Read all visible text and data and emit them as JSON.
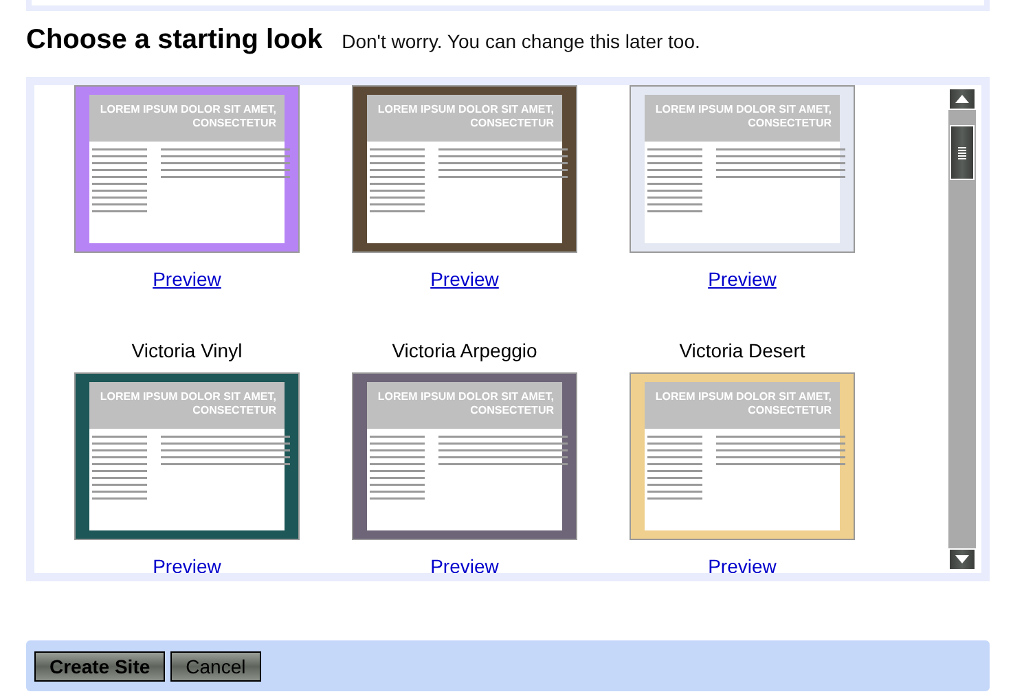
{
  "heading": {
    "title": "Choose a starting look",
    "subtitle": "Don't worry. You can change this later too."
  },
  "rows": [
    {
      "themes": [
        {
          "color": "#b784f5",
          "headline": "LOREM IPSUM DOLOR SIT AMET, CONSECTETUR",
          "link": "Preview"
        },
        {
          "color": "#5c4a36",
          "headline": "LOREM IPSUM DOLOR SIT AMET, CONSECTETUR",
          "link": "Preview"
        },
        {
          "color": "#e4e8f2",
          "headline": "LOREM IPSUM DOLOR SIT AMET, CONSECTETUR",
          "link": "Preview"
        }
      ]
    },
    {
      "themes": [
        {
          "name": "Victoria Vinyl",
          "color": "#1d5757",
          "headline": "LOREM IPSUM DOLOR SIT AMET, CONSECTETUR",
          "link": "Preview"
        },
        {
          "name": "Victoria Arpeggio",
          "color": "#6e6578",
          "headline": "LOREM IPSUM DOLOR SIT AMET, CONSECTETUR",
          "link": "Preview"
        },
        {
          "name": "Victoria Desert",
          "color": "#efd08e",
          "headline": "LOREM IPSUM DOLOR SIT AMET, CONSECTETUR",
          "link": "Preview"
        }
      ]
    }
  ],
  "buttons": [
    "Create Site",
    "Cancel"
  ]
}
